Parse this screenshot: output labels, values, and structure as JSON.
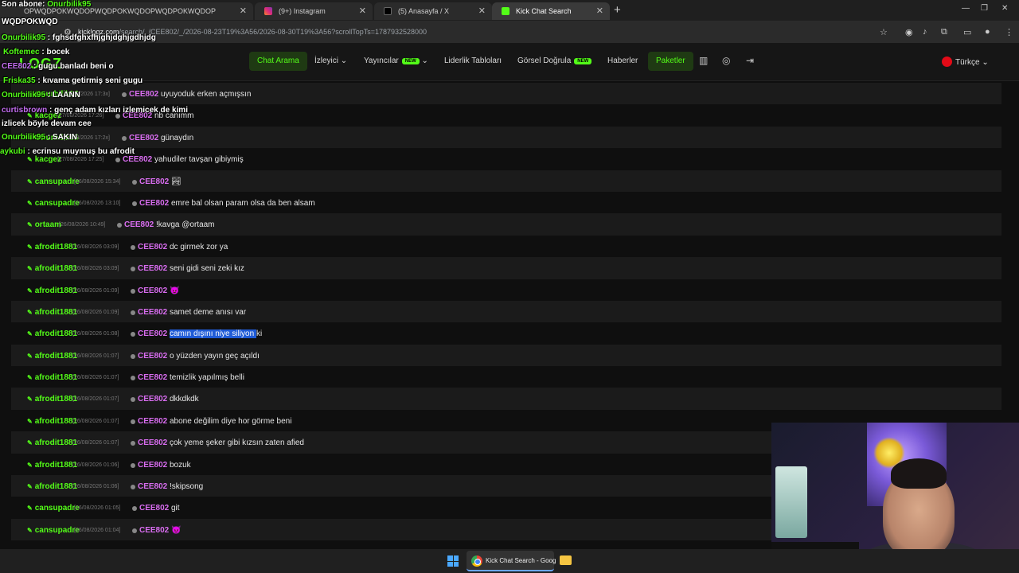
{
  "browser": {
    "tabs": [
      {
        "label": "OPWQDPOKWQDOPWQDPOKWQDOPWQDPOKWQDOP",
        "active": false
      },
      {
        "label": "(9+) Instagram",
        "active": false
      },
      {
        "label": "(5) Anasayfa / X",
        "active": false
      },
      {
        "label": "Kick Chat Search",
        "active": true
      }
    ],
    "new_tab": "+",
    "url_host": "kicklogz.com",
    "url_path": "/search/_/CEE802/_/2026-08-23T19%3A56/2026-08-30T19%3A56?scrollTopTs=1787932528000"
  },
  "navbar": {
    "logo": "LOGZ",
    "items": {
      "chat_arama": "Chat Arama",
      "izleyici": "İzleyici",
      "yayincilar": "Yayıncılar",
      "liderlik": "Liderlik Tabloları",
      "gorsel": "Görsel Doğrula",
      "haberler": "Haberler",
      "paketler": "Paketler"
    },
    "new_badge": "NEW",
    "language": "Türkçe"
  },
  "channel": "CEE802",
  "messages": [
    {
      "user": "Onurbilik95",
      "time": "[27/08/2026 17:3x]",
      "text": "uyuyoduk erken açmışsın"
    },
    {
      "user": "kacgez",
      "time": "[27/08/2026 17:26]",
      "text": "nb canımm"
    },
    {
      "user": "Onurbilik95",
      "time": "[27/08/2026 17:2x]",
      "text": "günaydın"
    },
    {
      "user": "kacgez",
      "time": "[27/08/2026 17:25]",
      "text": "yahudiler tavşan gibiymiş"
    },
    {
      "user": "cansupadre",
      "time": "[26/08/2026 15:34]",
      "text": "🏞"
    },
    {
      "user": "cansupadre",
      "time": "[26/08/2026 13:10]",
      "text": "emre bal olsan param olsa da ben alsam"
    },
    {
      "user": "ortaam",
      "time": "[26/08/2026 10:49]",
      "text": "!kavga @ortaam"
    },
    {
      "user": "afrodit1881",
      "time": "[26/08/2026 03:09]",
      "text": "dc girmek zor ya"
    },
    {
      "user": "afrodit1881",
      "time": "[26/08/2026 03:09]",
      "text": "seni gidi seni zeki kız"
    },
    {
      "user": "afrodit1881",
      "time": "[26/08/2026 01:09]",
      "text": "😈"
    },
    {
      "user": "afrodit1881",
      "time": "[26/08/2026 01:09]",
      "text": "samet deme anısı var"
    },
    {
      "user": "afrodit1881",
      "time": "[26/08/2026 01:08]",
      "text": "camın dışını niye siliyon ki",
      "selected": "camın dışını niye siliyon "
    },
    {
      "user": "afrodit1881",
      "time": "[26/08/2026 01:07]",
      "text": "o yüzden yayın geç açıldı"
    },
    {
      "user": "afrodit1881",
      "time": "[26/08/2026 01:07]",
      "text": "temizlik yapılmış belli"
    },
    {
      "user": "afrodit1881",
      "time": "[26/08/2026 01:07]",
      "text": "dkkdkdk"
    },
    {
      "user": "afrodit1881",
      "time": "[26/08/2026 01:07]",
      "text": "abone değilim diye hor görme beni"
    },
    {
      "user": "afrodit1881",
      "time": "[26/08/2026 01:07]",
      "text": "çok yeme şeker gibi kızsın zaten afied"
    },
    {
      "user": "afrodit1881",
      "time": "[26/08/2026 01:06]",
      "text": "bozuk"
    },
    {
      "user": "afrodit1881",
      "time": "[26/08/2026 01:06]",
      "text": "!skipsong"
    },
    {
      "user": "cansupadre",
      "time": "[26/08/2026 01:05]",
      "text": "git"
    },
    {
      "user": "cansupadre",
      "time": "[26/08/2026 01:04]",
      "text": "😈"
    }
  ],
  "overlay": [
    {
      "prefix": "Son abone: ",
      "name": "Onurbilik95",
      "text": ""
    },
    {
      "prefix": "",
      "name": "",
      "text": "WQDPOKWQD"
    },
    {
      "prefix": "",
      "name": "Onurbilik95",
      "text": " : fghsdfghxfhjghjdghjgdhjdg"
    },
    {
      "prefix": "",
      "name": "Koftemec",
      "text": " : bocek"
    },
    {
      "prefix": "",
      "name": "CEE802",
      "text": " : gugu banladı beni o"
    },
    {
      "prefix": "",
      "name": "Friska35",
      "text": " : kıvama getirmiş seni gugu"
    },
    {
      "prefix": "",
      "name": "Onurbilik95",
      "text": " : LAANN"
    },
    {
      "prefix": "",
      "name": "curtisbrown",
      "text": " : genç adam kızları izlemicek de kimi"
    },
    {
      "prefix": "",
      "name": "",
      "text": "izlicek böyle devam cee"
    },
    {
      "prefix": "",
      "name": "Onurbilik95",
      "text": " : SAKIN"
    },
    {
      "prefix": "",
      "name": "aykubi",
      "text": " : ecrinsu muymuş bu afrodit"
    }
  ],
  "taskbar": {
    "active_app": "Kick Chat Search - Goog"
  },
  "colors": {
    "accent": "#53fc18",
    "channel": "#d96df0",
    "selection": "#1f5bd6"
  }
}
